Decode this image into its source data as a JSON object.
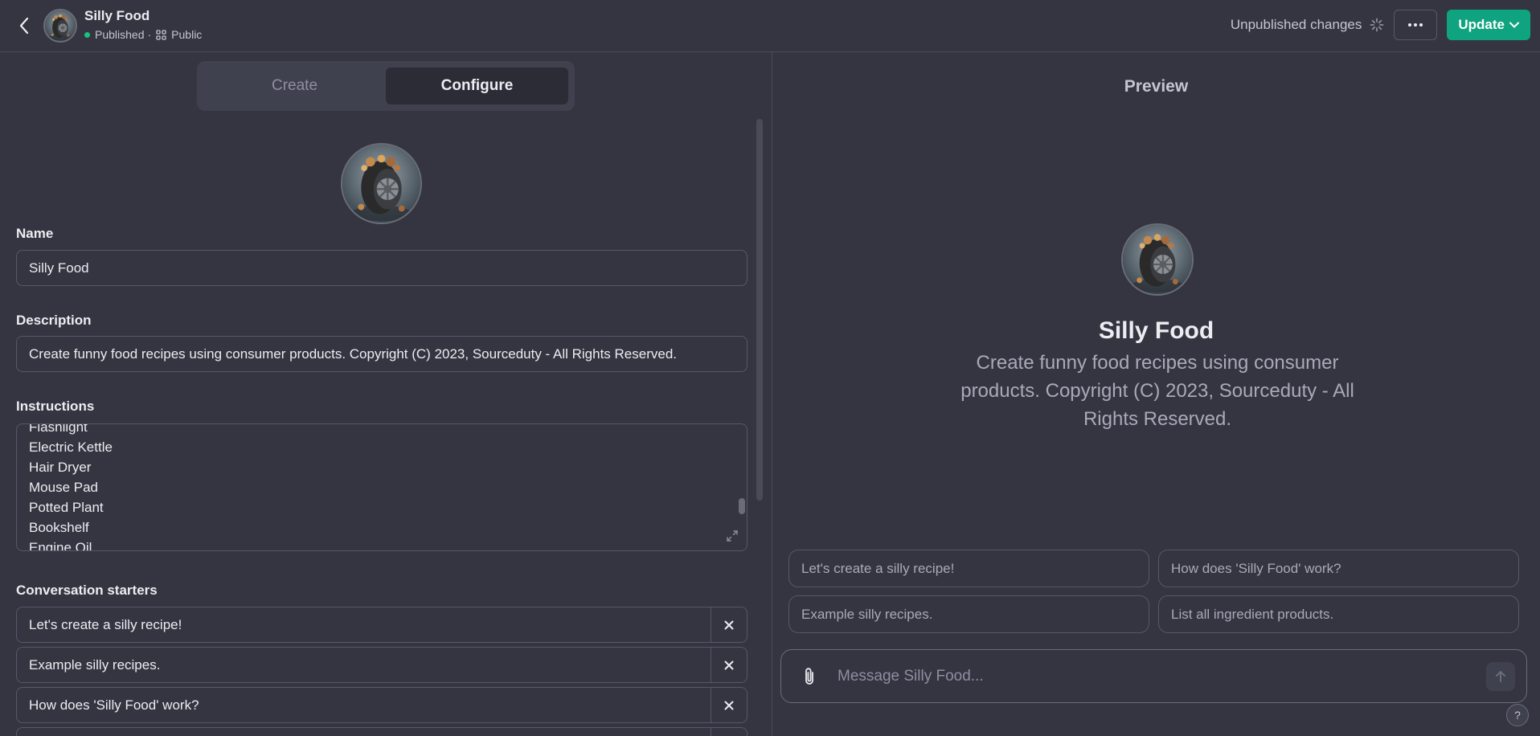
{
  "header": {
    "title": "Silly Food",
    "status": "Published",
    "separator": "·",
    "visibility": "Public",
    "unpublished_label": "Unpublished changes",
    "update_label": "Update"
  },
  "editor": {
    "tabs": [
      {
        "label": "Create",
        "active": false
      },
      {
        "label": "Configure",
        "active": true
      }
    ],
    "name_label": "Name",
    "name_value": "Silly Food",
    "description_label": "Description",
    "description_value": "Create funny food recipes using consumer products. Copyright (C) 2023, Sourceduty - All Rights Reserved.",
    "instructions_label": "Instructions",
    "instructions_lines": [
      "Flashlight",
      "Electric Kettle",
      "Hair Dryer",
      "Mouse Pad",
      "Potted Plant",
      "Bookshelf",
      "Engine Oil"
    ],
    "starters_label": "Conversation starters",
    "starters": [
      "Let's create a silly recipe!",
      "Example silly recipes.",
      "How does 'Silly Food' work?"
    ]
  },
  "preview": {
    "title": "Preview",
    "name": "Silly Food",
    "description": "Create funny food recipes using consumer products. Copyright (C) 2023, Sourceduty - All Rights Reserved.",
    "chips": [
      "Let's create a silly recipe!",
      "How does 'Silly Food' work?",
      "Example silly recipes.",
      "List all ingredient products."
    ],
    "message_placeholder": "Message Silly Food..."
  },
  "help_label": "?",
  "colors": {
    "background": "#343541",
    "accent": "#10a37f",
    "status_dot": "#19c37d",
    "border": "#565869"
  },
  "icons": [
    "chevron-left-icon",
    "network-icon",
    "spinner-icon",
    "ellipsis-icon",
    "chevron-down-icon",
    "expand-icon",
    "close-icon",
    "paperclip-icon",
    "arrow-up-icon"
  ]
}
